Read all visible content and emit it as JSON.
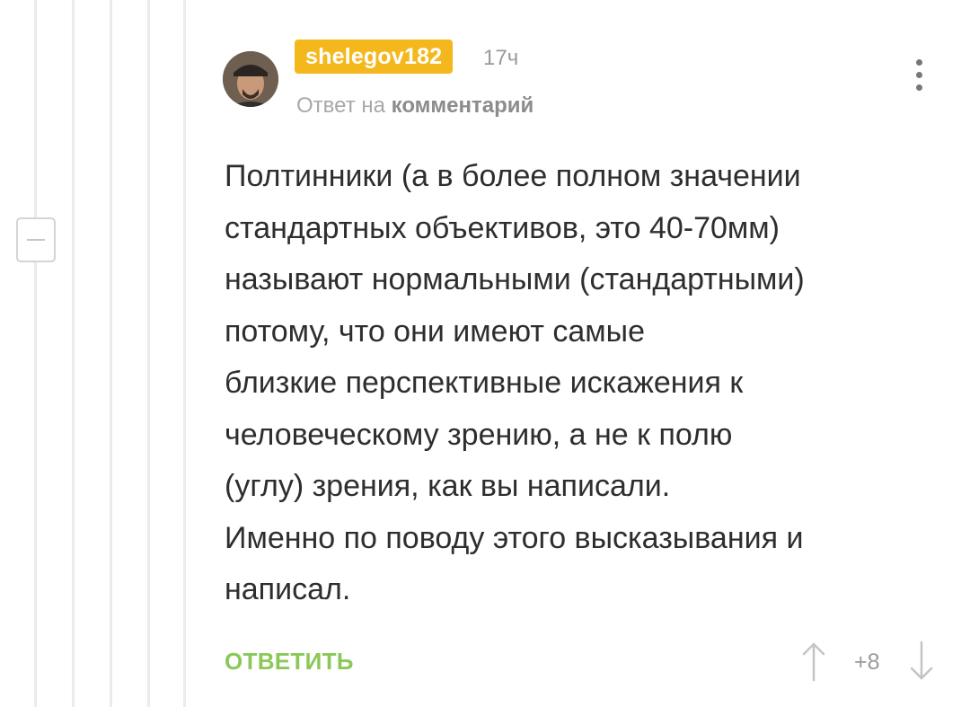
{
  "comment": {
    "author": "shelegov182",
    "timestamp": "17ч",
    "reply_prefix": "Ответ на",
    "reply_link": "комментарий",
    "body_lines": [
      "Полтинники (а в более полном значении",
      "стандартных объективов, это 40-70мм)",
      "называют нормальными (стандартными)",
      "потому, что они имеют самые",
      "близкие перспективные искажения к",
      "человеческому зрению, а не к полю",
      "(углу) зрения, как вы написали.",
      "Именно по поводу этого высказывания и",
      "написал."
    ],
    "reply_label": "ОТВЕТИТЬ",
    "rating": "+8"
  },
  "icons": {
    "collapse": "minus-icon",
    "menu": "more-vertical-icon",
    "upvote": "arrow-up-icon",
    "downvote": "arrow-down-icon"
  },
  "colors": {
    "username_badge": "#f5b81c",
    "reply_button": "#8ac858",
    "text": "#2e2e2e",
    "muted": "#9a9a9a"
  }
}
